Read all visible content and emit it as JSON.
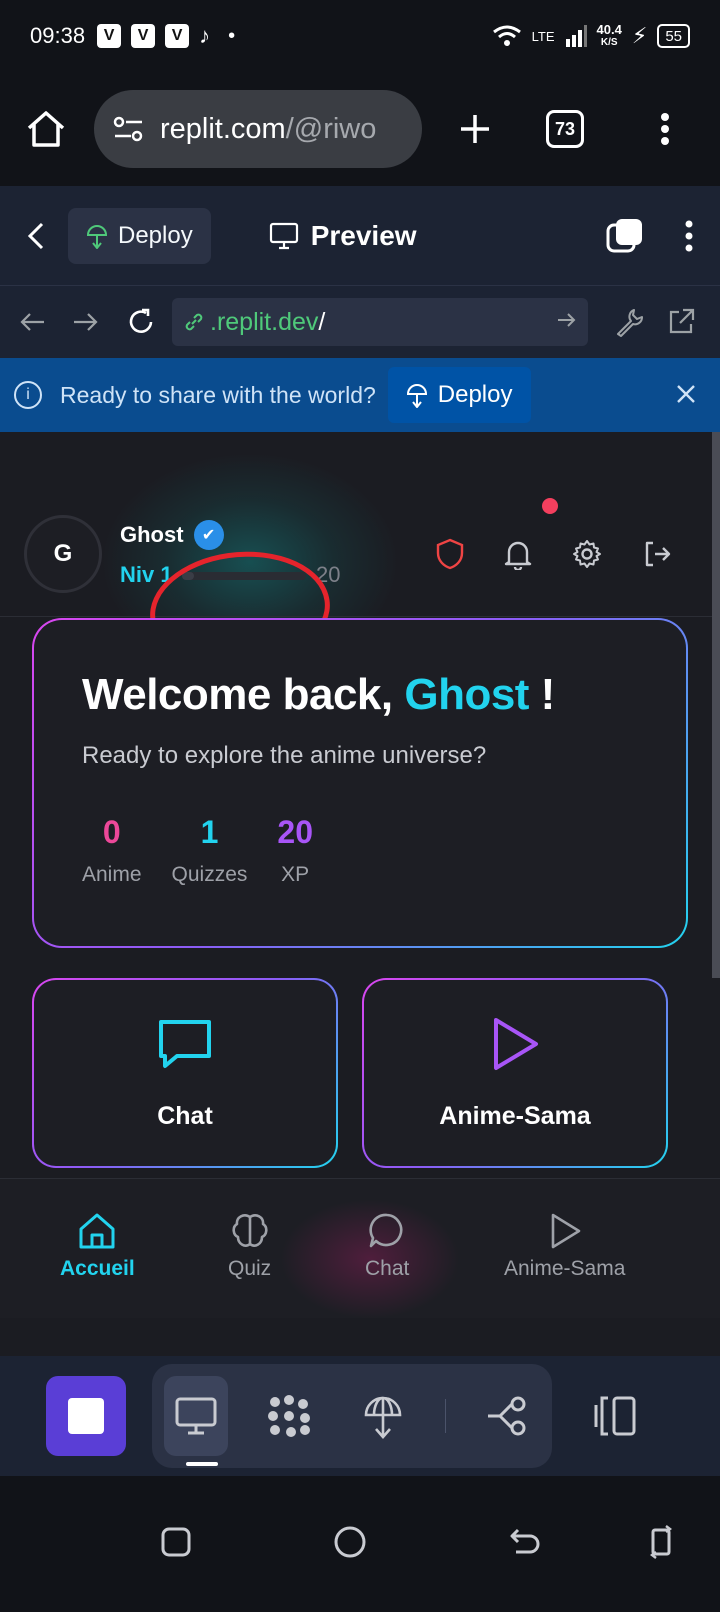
{
  "status_bar": {
    "time": "09:38",
    "app_icons": [
      "V",
      "V",
      "V",
      "♪"
    ],
    "lte": "LTE",
    "speed": "40.4",
    "speed_unit": "K/S",
    "battery": "55"
  },
  "browser": {
    "url_main": "replit.com",
    "url_dim": "/@riwo",
    "tab_count": "73"
  },
  "replit_header": {
    "deploy_label": "Deploy",
    "preview_label": "Preview"
  },
  "address_bar": {
    "url_green": ".replit.dev",
    "url_rest": "/"
  },
  "banner": {
    "message": "Ready to share with the world?",
    "deploy_label": "Deploy"
  },
  "user": {
    "avatar_letter": "G",
    "name": "Ghost",
    "verified_mark": "✔",
    "level_label": "Niv 1",
    "xp_value": "20",
    "xp_progress": 0.1
  },
  "welcome": {
    "title_prefix": "Welcome back, ",
    "title_name": "Ghost",
    "title_suffix": " !",
    "subtitle": "Ready to explore the anime universe?",
    "stats": [
      {
        "value": "0",
        "label": "Anime",
        "color": "#ec4899"
      },
      {
        "value": "1",
        "label": "Quizzes",
        "color": "#22d3ee"
      },
      {
        "value": "20",
        "label": "XP",
        "color": "#a855f7"
      }
    ]
  },
  "tiles": [
    {
      "label": "Chat",
      "icon": "chat-bubble-icon",
      "color": "#22d3ee"
    },
    {
      "label": "Anime-Sama",
      "icon": "play-icon",
      "color": "#a855f7"
    }
  ],
  "bottom_nav": [
    {
      "label": "Accueil",
      "icon": "home-icon",
      "active": true
    },
    {
      "label": "Quiz",
      "icon": "brain-icon",
      "active": false
    },
    {
      "label": "Chat",
      "icon": "chat-icon",
      "active": false
    },
    {
      "label": "Anime-Sama",
      "icon": "play-icon",
      "active": false
    }
  ],
  "colors": {
    "accent_cyan": "#22d3ee",
    "accent_pink": "#ec4899",
    "accent_purple": "#a855f7",
    "replit_bg": "#1c2333",
    "banner_bg": "#0a4c8f"
  }
}
